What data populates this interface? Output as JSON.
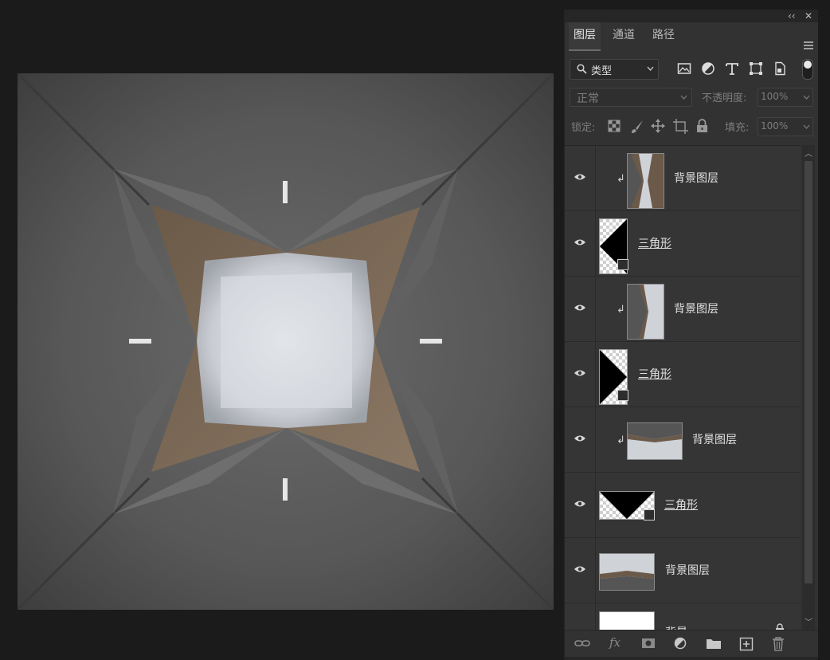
{
  "panel": {
    "tabs": [
      {
        "label": "图层",
        "active": true
      },
      {
        "label": "通道",
        "active": false
      },
      {
        "label": "路径",
        "active": false
      }
    ],
    "collapse_glyph": "‹‹",
    "close_glyph": "✕"
  },
  "filter": {
    "kind_label": "类型",
    "icons": [
      "image-filter-icon",
      "adjustment-filter-icon",
      "type-filter-icon",
      "shape-filter-icon",
      "smart-object-filter-icon"
    ]
  },
  "blend": {
    "mode": "正常",
    "opacity_label": "不透明度:",
    "opacity_value": "100%"
  },
  "lock": {
    "label": "锁定:",
    "fill_label": "填充:",
    "fill_value": "100%"
  },
  "layers": [
    {
      "name": "背景图层",
      "type": "image",
      "clipped": true,
      "visible": true,
      "thumb": "vertical-flipped"
    },
    {
      "name": "三角形",
      "type": "shape",
      "clipped": false,
      "visible": true,
      "thumb": "triangle-left"
    },
    {
      "name": "背景图层",
      "type": "image",
      "clipped": true,
      "visible": true,
      "thumb": "vertical"
    },
    {
      "name": "三角形",
      "type": "shape",
      "clipped": false,
      "visible": true,
      "thumb": "triangle-right"
    },
    {
      "name": "背景图层",
      "type": "image",
      "clipped": true,
      "visible": true,
      "thumb": "horizontal-flipped"
    },
    {
      "name": "三角形",
      "type": "shape",
      "clipped": false,
      "visible": true,
      "thumb": "triangle-down"
    },
    {
      "name": "背景图层",
      "type": "image",
      "clipped": false,
      "visible": true,
      "thumb": "horizontal"
    },
    {
      "name": "背景",
      "type": "background",
      "clipped": false,
      "visible": true,
      "locked": true,
      "thumb": "white"
    }
  ],
  "footer": {
    "icons": [
      "link-layers-icon",
      "fx-icon",
      "add-mask-icon",
      "new-adjustment-icon",
      "new-group-icon",
      "new-layer-icon",
      "delete-layer-icon"
    ],
    "fx_label": "fx"
  },
  "colors": {
    "app_bg": "#1b1b1b",
    "panel_bg": "#323232",
    "layer_bg": "#353535",
    "text": "#e1e1e1"
  }
}
